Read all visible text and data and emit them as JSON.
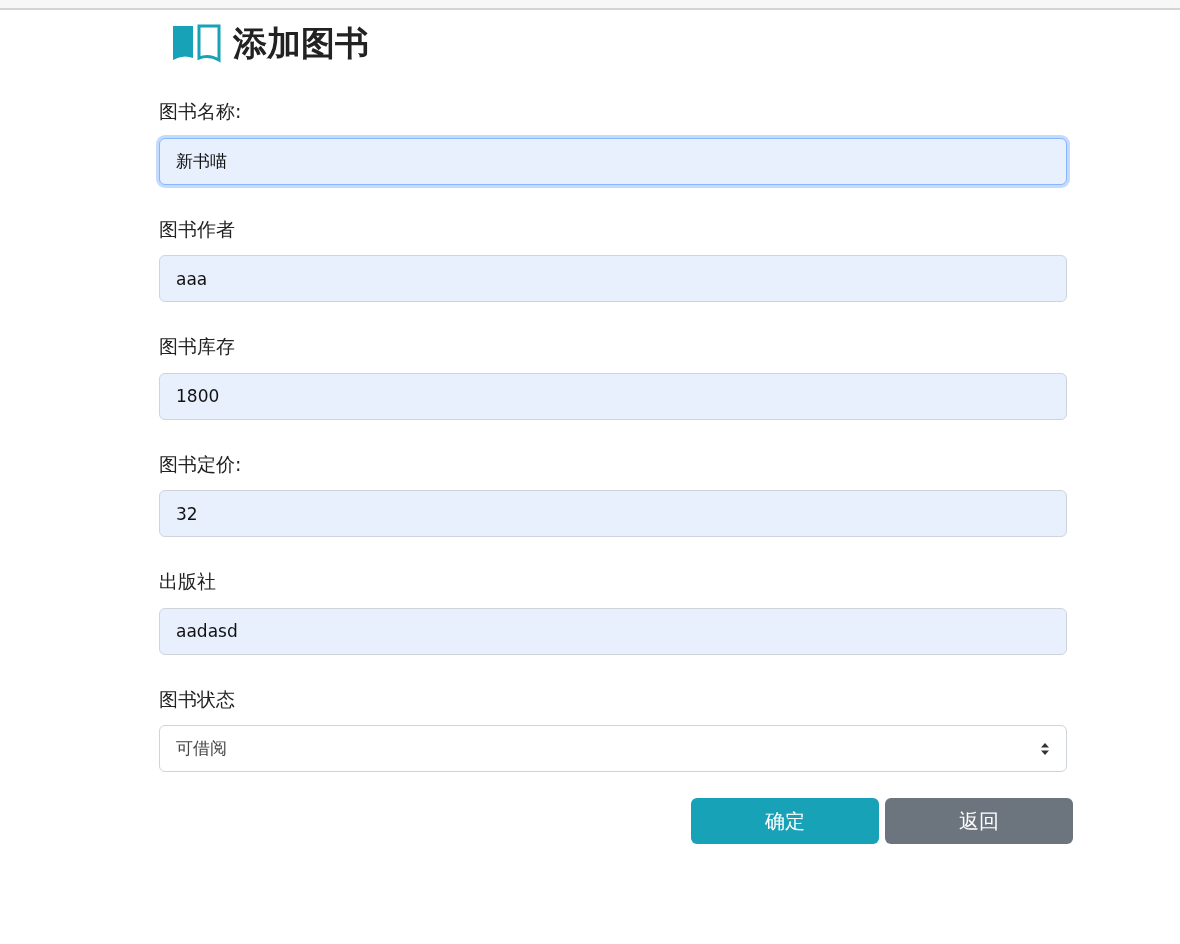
{
  "title": "添加图书",
  "fields": [
    {
      "kind": "input",
      "label": "图书名称:",
      "value": "新书喵",
      "focused": true
    },
    {
      "kind": "input",
      "label": "图书作者",
      "value": "aaa",
      "focused": false
    },
    {
      "kind": "input",
      "label": "图书库存",
      "value": "1800",
      "focused": false
    },
    {
      "kind": "input",
      "label": "图书定价:",
      "value": "32",
      "focused": false
    },
    {
      "kind": "input",
      "label": "出版社",
      "value": "aadasd",
      "focused": false
    },
    {
      "kind": "select",
      "label": "图书状态",
      "value": "可借阅",
      "focused": false
    }
  ],
  "buttons": [
    {
      "kind": "primary",
      "label": "确定"
    },
    {
      "kind": "secondary",
      "label": "返回"
    }
  ]
}
